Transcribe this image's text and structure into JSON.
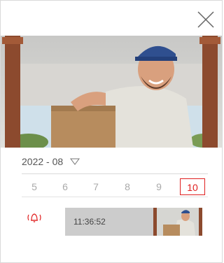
{
  "month": {
    "label": "2022 - 08",
    "dropdown_icon": "triangle-down-icon"
  },
  "days": [
    "5",
    "6",
    "7",
    "8",
    "9",
    "10"
  ],
  "selected_day": "10",
  "events": [
    {
      "time": "11:36:52",
      "icon": "doorbell-ring-icon"
    }
  ],
  "colors": {
    "accent": "#e02020",
    "event_bg": "#cccccc"
  },
  "icons": {
    "close": "close-icon",
    "bell": "doorbell-ring-icon"
  }
}
